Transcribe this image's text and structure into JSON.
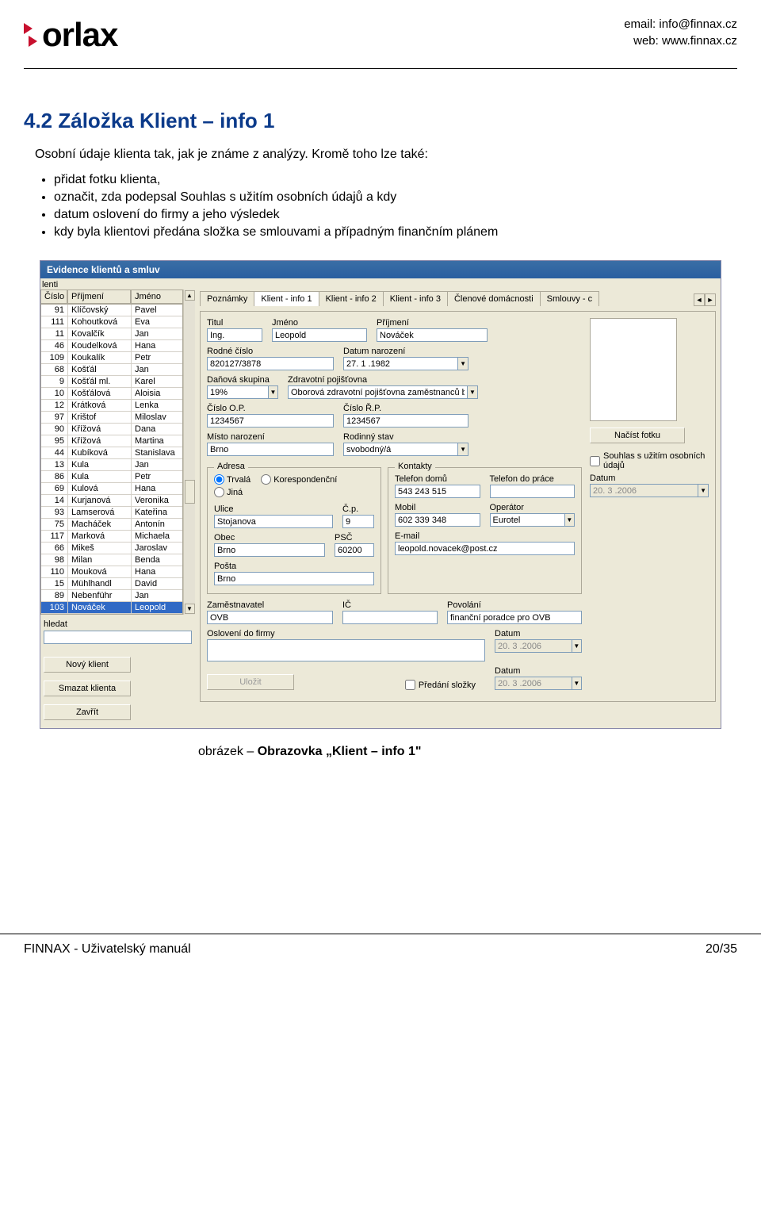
{
  "header": {
    "logo_text": "orlax",
    "email_line": "email: info@finnax.cz",
    "web_line": "web: www.finnax.cz"
  },
  "section": {
    "number_title": "4.2  Záložka Klient – info 1",
    "intro": "Osobní údaje klienta tak, jak je známe z analýzy. Kromě toho lze také:",
    "bullets": [
      "přidat fotku klienta,",
      "označit, zda podepsal Souhlas s užitím osobních údajů a kdy",
      "datum oslovení do firmy a jeho výsledek",
      "kdy byla klientovi předána složka se smlouvami a případným finančním plánem"
    ]
  },
  "app": {
    "title": "Evidence klientů a smluv",
    "left_header": "lenti",
    "columns": {
      "num": "Číslo",
      "surname": "Příjmení",
      "name": "Jméno"
    },
    "rows": [
      {
        "num": "91",
        "surname": "Klíčovský",
        "name": "Pavel"
      },
      {
        "num": "111",
        "surname": "Kohoutková",
        "name": "Eva"
      },
      {
        "num": "11",
        "surname": "Kovalčík",
        "name": "Jan"
      },
      {
        "num": "46",
        "surname": "Koudelková",
        "name": "Hana"
      },
      {
        "num": "109",
        "surname": "Koukalík",
        "name": "Petr"
      },
      {
        "num": "68",
        "surname": "Košťál",
        "name": "Jan"
      },
      {
        "num": "9",
        "surname": "Košťál ml.",
        "name": "Karel"
      },
      {
        "num": "10",
        "surname": "Košťálová",
        "name": "Aloisia"
      },
      {
        "num": "12",
        "surname": "Krátková",
        "name": "Lenka"
      },
      {
        "num": "97",
        "surname": "Krištof",
        "name": "Miloslav"
      },
      {
        "num": "90",
        "surname": "Křížová",
        "name": "Dana"
      },
      {
        "num": "95",
        "surname": "Křížová",
        "name": "Martina"
      },
      {
        "num": "44",
        "surname": "Kubíková",
        "name": "Stanislava"
      },
      {
        "num": "13",
        "surname": "Kula",
        "name": "Jan"
      },
      {
        "num": "86",
        "surname": "Kula",
        "name": "Petr"
      },
      {
        "num": "69",
        "surname": "Kulová",
        "name": "Hana"
      },
      {
        "num": "14",
        "surname": "Kurjanová",
        "name": "Veronika"
      },
      {
        "num": "93",
        "surname": "Lamserová",
        "name": "Kateřina"
      },
      {
        "num": "75",
        "surname": "Macháček",
        "name": "Antonín"
      },
      {
        "num": "117",
        "surname": "Marková",
        "name": "Michaela"
      },
      {
        "num": "66",
        "surname": "Mikeš",
        "name": "Jaroslav"
      },
      {
        "num": "98",
        "surname": "Milan",
        "name": "Benda"
      },
      {
        "num": "110",
        "surname": "Mouková",
        "name": "Hana"
      },
      {
        "num": "15",
        "surname": "Mühlhandl",
        "name": "David"
      },
      {
        "num": "89",
        "surname": "Nebenführ",
        "name": "Jan"
      },
      {
        "num": "103",
        "surname": "Nováček",
        "name": "Leopold",
        "selected": true
      }
    ],
    "search_label": "hledat",
    "btn_new": "Nový klient",
    "btn_delete": "Smazat klienta",
    "btn_close": "Zavřít",
    "tabs": {
      "notes": "Poznámky",
      "info1": "Klient - info 1",
      "info2": "Klient - info 2",
      "info3": "Klient - info 3",
      "household": "Členové domácnosti",
      "contracts": "Smlouvy - c"
    },
    "labels": {
      "titul": "Titul",
      "jmeno": "Jméno",
      "prijmeni": "Příjmení",
      "rc": "Rodné číslo",
      "dob": "Datum narození",
      "taxgrp": "Daňová skupina",
      "insurance": "Zdravotní pojišťovna",
      "op": "Číslo O.P.",
      "rp": "Číslo Ř.P.",
      "birthplace": "Místo narození",
      "marital": "Rodinný stav",
      "adresa": "Adresa",
      "trvala": "Trvalá",
      "koresp": "Korespondenční",
      "jina": "Jiná",
      "ulice": "Ulice",
      "cp": "Č.p.",
      "obec": "Obec",
      "psc": "PSČ",
      "posta": "Pošta",
      "kontakty": "Kontakty",
      "tel_home": "Telefon domů",
      "tel_work": "Telefon do práce",
      "mobil": "Mobil",
      "operator": "Operátor",
      "email": "E-mail",
      "employer": "Zaměstnavatel",
      "ic": "IČ",
      "occupation": "Povolání",
      "osloveni": "Oslovení do firmy",
      "datum": "Datum",
      "predani": "Předání složky",
      "load_photo": "Načíst fotku",
      "consent": "Souhlas s užitím osobních údajů",
      "save": "Uložit"
    },
    "values": {
      "titul": "Ing.",
      "jmeno": "Leopold",
      "prijmeni": "Nováček",
      "rc": "820127/3878",
      "dob": "27. 1 .1982",
      "taxgrp": "19%",
      "insurance": "Oborová zdravotní pojišťovna zaměstnanců b",
      "op": "1234567",
      "rp": "1234567",
      "birthplace": "Brno",
      "marital": "svobodný/á",
      "ulice": "Stojanova",
      "cp": "9",
      "obec": "Brno",
      "psc": "60200",
      "posta": "Brno",
      "tel_home": "543 243 515",
      "tel_work": "",
      "mobil": "602 339 348",
      "operator": "Eurotel",
      "email": "leopold.novacek@post.cz",
      "employer": "OVB",
      "ic": "",
      "occupation": "finanční poradce pro OVB",
      "osloveni": "",
      "datum1": "20. 3 .2006",
      "datum2": "20. 3 .2006",
      "datum3": "20. 3 .2006"
    }
  },
  "caption": "obrázek – Obrazovka „Klient – info 1\"",
  "caption_prefix": "obrázek – ",
  "caption_bold": "Obrazovka „Klient – info 1\"",
  "footer": {
    "left": "FINNAX - Uživatelský manuál",
    "right": "20/35"
  }
}
